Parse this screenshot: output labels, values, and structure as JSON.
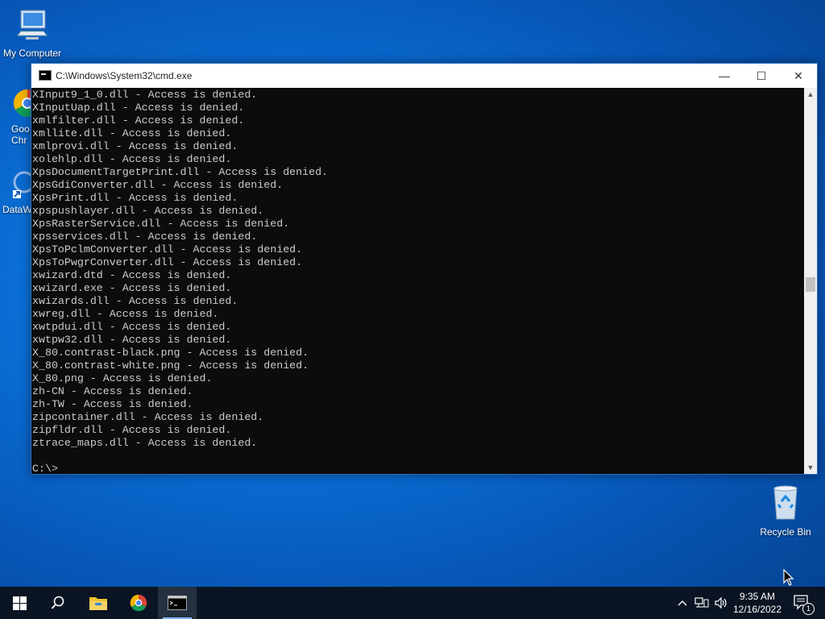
{
  "desktop": {
    "icons": [
      {
        "label": "My Computer"
      },
      {
        "label": "Goo\nChr"
      },
      {
        "label": "DataW"
      },
      {
        "label": "Recycle Bin"
      }
    ]
  },
  "window": {
    "title": "C:\\Windows\\System32\\cmd.exe",
    "minimize": "—",
    "maximize": "☐",
    "close": "✕",
    "lines": [
      "XInput9_1_0.dll - Access is denied.",
      "XInputUap.dll - Access is denied.",
      "xmlfilter.dll - Access is denied.",
      "xmllite.dll - Access is denied.",
      "xmlprovi.dll - Access is denied.",
      "xolehlp.dll - Access is denied.",
      "XpsDocumentTargetPrint.dll - Access is denied.",
      "XpsGdiConverter.dll - Access is denied.",
      "XpsPrint.dll - Access is denied.",
      "xpspushlayer.dll - Access is denied.",
      "XpsRasterService.dll - Access is denied.",
      "xpsservices.dll - Access is denied.",
      "XpsToPclmConverter.dll - Access is denied.",
      "XpsToPwgrConverter.dll - Access is denied.",
      "xwizard.dtd - Access is denied.",
      "xwizard.exe - Access is denied.",
      "xwizards.dll - Access is denied.",
      "xwreg.dll - Access is denied.",
      "xwtpdui.dll - Access is denied.",
      "xwtpw32.dll - Access is denied.",
      "X_80.contrast-black.png - Access is denied.",
      "X_80.contrast-white.png - Access is denied.",
      "X_80.png - Access is denied.",
      "zh-CN - Access is denied.",
      "zh-TW - Access is denied.",
      "zipcontainer.dll - Access is denied.",
      "zipfldr.dll - Access is denied.",
      "ztrace_maps.dll - Access is denied.",
      "",
      "C:\\>"
    ]
  },
  "taskbar": {
    "clock_time": "9:35 AM",
    "clock_date": "12/16/2022",
    "notification_count": "1",
    "icons": [
      "windows-start-icon",
      "search-icon",
      "file-explorer-icon",
      "chrome-icon",
      "cmd-icon"
    ]
  }
}
